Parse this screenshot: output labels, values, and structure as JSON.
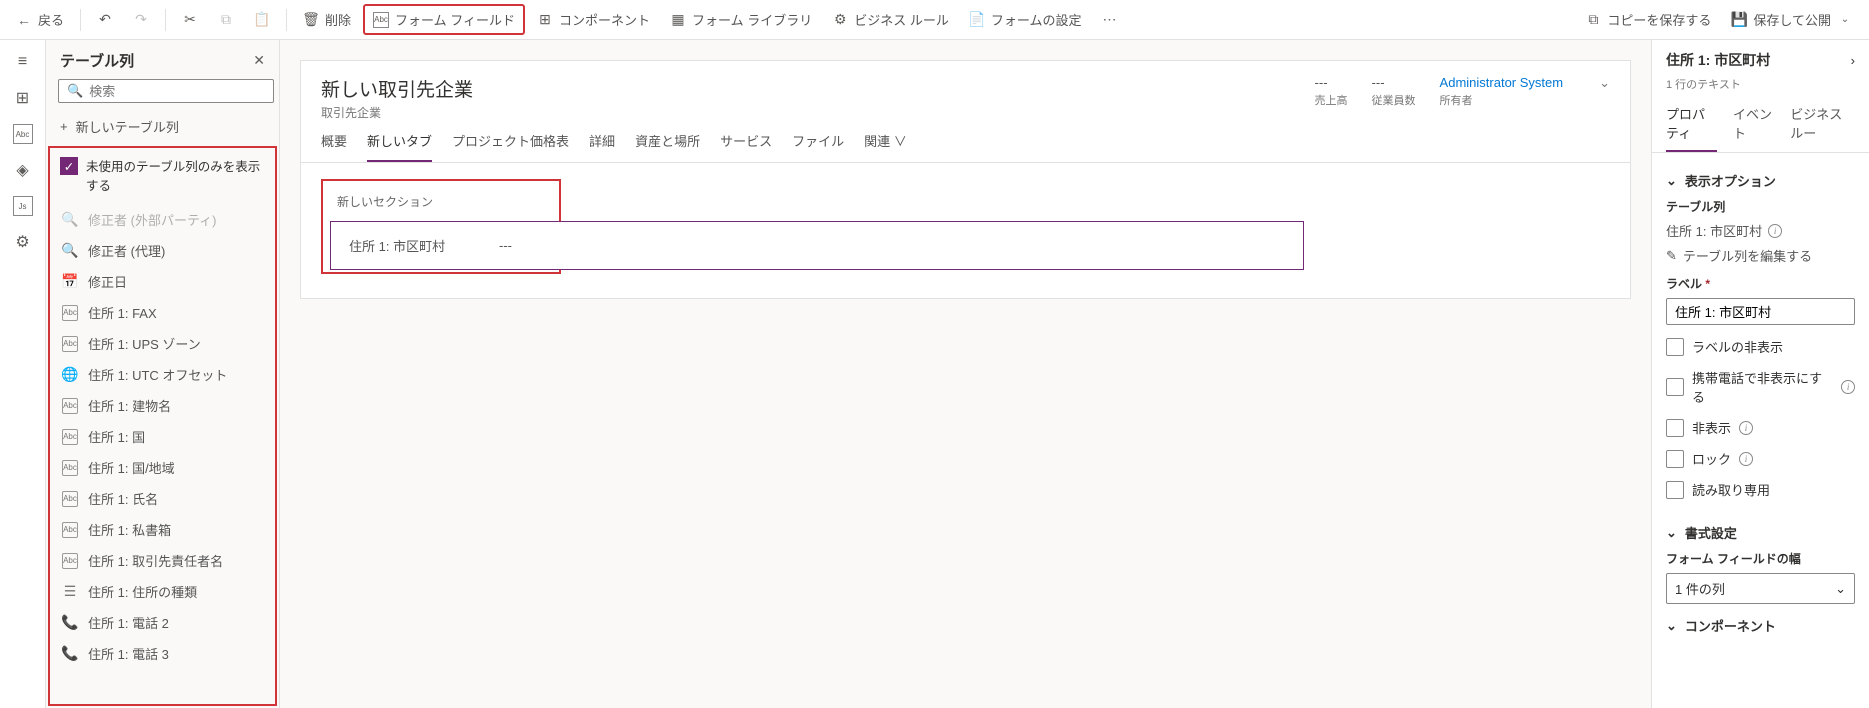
{
  "toolbar": {
    "back": "戻る",
    "delete": "削除",
    "form_field": "フォーム フィールド",
    "component": "コンポーネント",
    "form_library": "フォーム ライブラリ",
    "business_rule": "ビジネス ルール",
    "form_settings": "フォームの設定",
    "save_copy": "コピーを保存する",
    "save_publish": "保存して公開"
  },
  "left_panel": {
    "title": "テーブル列",
    "search_placeholder": "検索",
    "add_new": "新しいテーブル列",
    "show_unused": "未使用のテーブル列のみを表示する",
    "items": [
      {
        "icon": "search",
        "label": "修正者 (外部パーティ)",
        "faded": true
      },
      {
        "icon": "search",
        "label": "修正者 (代理)"
      },
      {
        "icon": "cal",
        "label": "修正日"
      },
      {
        "icon": "abc",
        "label": "住所 1: FAX"
      },
      {
        "icon": "abc",
        "label": "住所 1: UPS ゾーン"
      },
      {
        "icon": "globe",
        "label": "住所 1: UTC オフセット"
      },
      {
        "icon": "abc",
        "label": "住所 1: 建物名"
      },
      {
        "icon": "abc",
        "label": "住所 1: 国"
      },
      {
        "icon": "abc",
        "label": "住所 1: 国/地域"
      },
      {
        "icon": "abc",
        "label": "住所 1: 氏名"
      },
      {
        "icon": "abc",
        "label": "住所 1: 私書箱"
      },
      {
        "icon": "abc",
        "label": "住所 1: 取引先責任者名"
      },
      {
        "icon": "list",
        "label": "住所 1: 住所の種類"
      },
      {
        "icon": "phone",
        "label": "住所 1: 電話 2"
      },
      {
        "icon": "phone",
        "label": "住所 1: 電話 3"
      }
    ]
  },
  "form": {
    "title": "新しい取引先企業",
    "subtitle": "取引先企業",
    "stats": [
      {
        "value": "---",
        "label": "売上高"
      },
      {
        "value": "---",
        "label": "従業員数"
      }
    ],
    "owner": {
      "value": "Administrator System",
      "label": "所有者"
    },
    "tabs": [
      "概要",
      "新しいタブ",
      "プロジェクト価格表",
      "詳細",
      "資産と場所",
      "サービス",
      "ファイル",
      "関連 ∨"
    ],
    "active_tab": 1,
    "section_label": "新しいセクション",
    "field": {
      "label": "住所 1: 市区町村",
      "value": "---"
    }
  },
  "right_panel": {
    "title": "住所 1: 市区町村",
    "subtitle": "1 行のテキスト",
    "tabs": [
      "プロパティ",
      "イベント",
      "ビジネス ルー"
    ],
    "active_tab": 0,
    "display_options": "表示オプション",
    "table_column_label": "テーブル列",
    "table_column_value": "住所 1: 市区町村",
    "edit_column": "テーブル列を編集する",
    "label_label": "ラベル",
    "label_value": "住所 1: 市区町村",
    "checks": [
      "ラベルの非表示",
      "携帯電話で非表示にする",
      "非表示",
      "ロック",
      "読み取り専用"
    ],
    "formatting": "書式設定",
    "field_width_label": "フォーム フィールドの幅",
    "field_width_value": "1 件の列",
    "components": "コンポーネント"
  }
}
